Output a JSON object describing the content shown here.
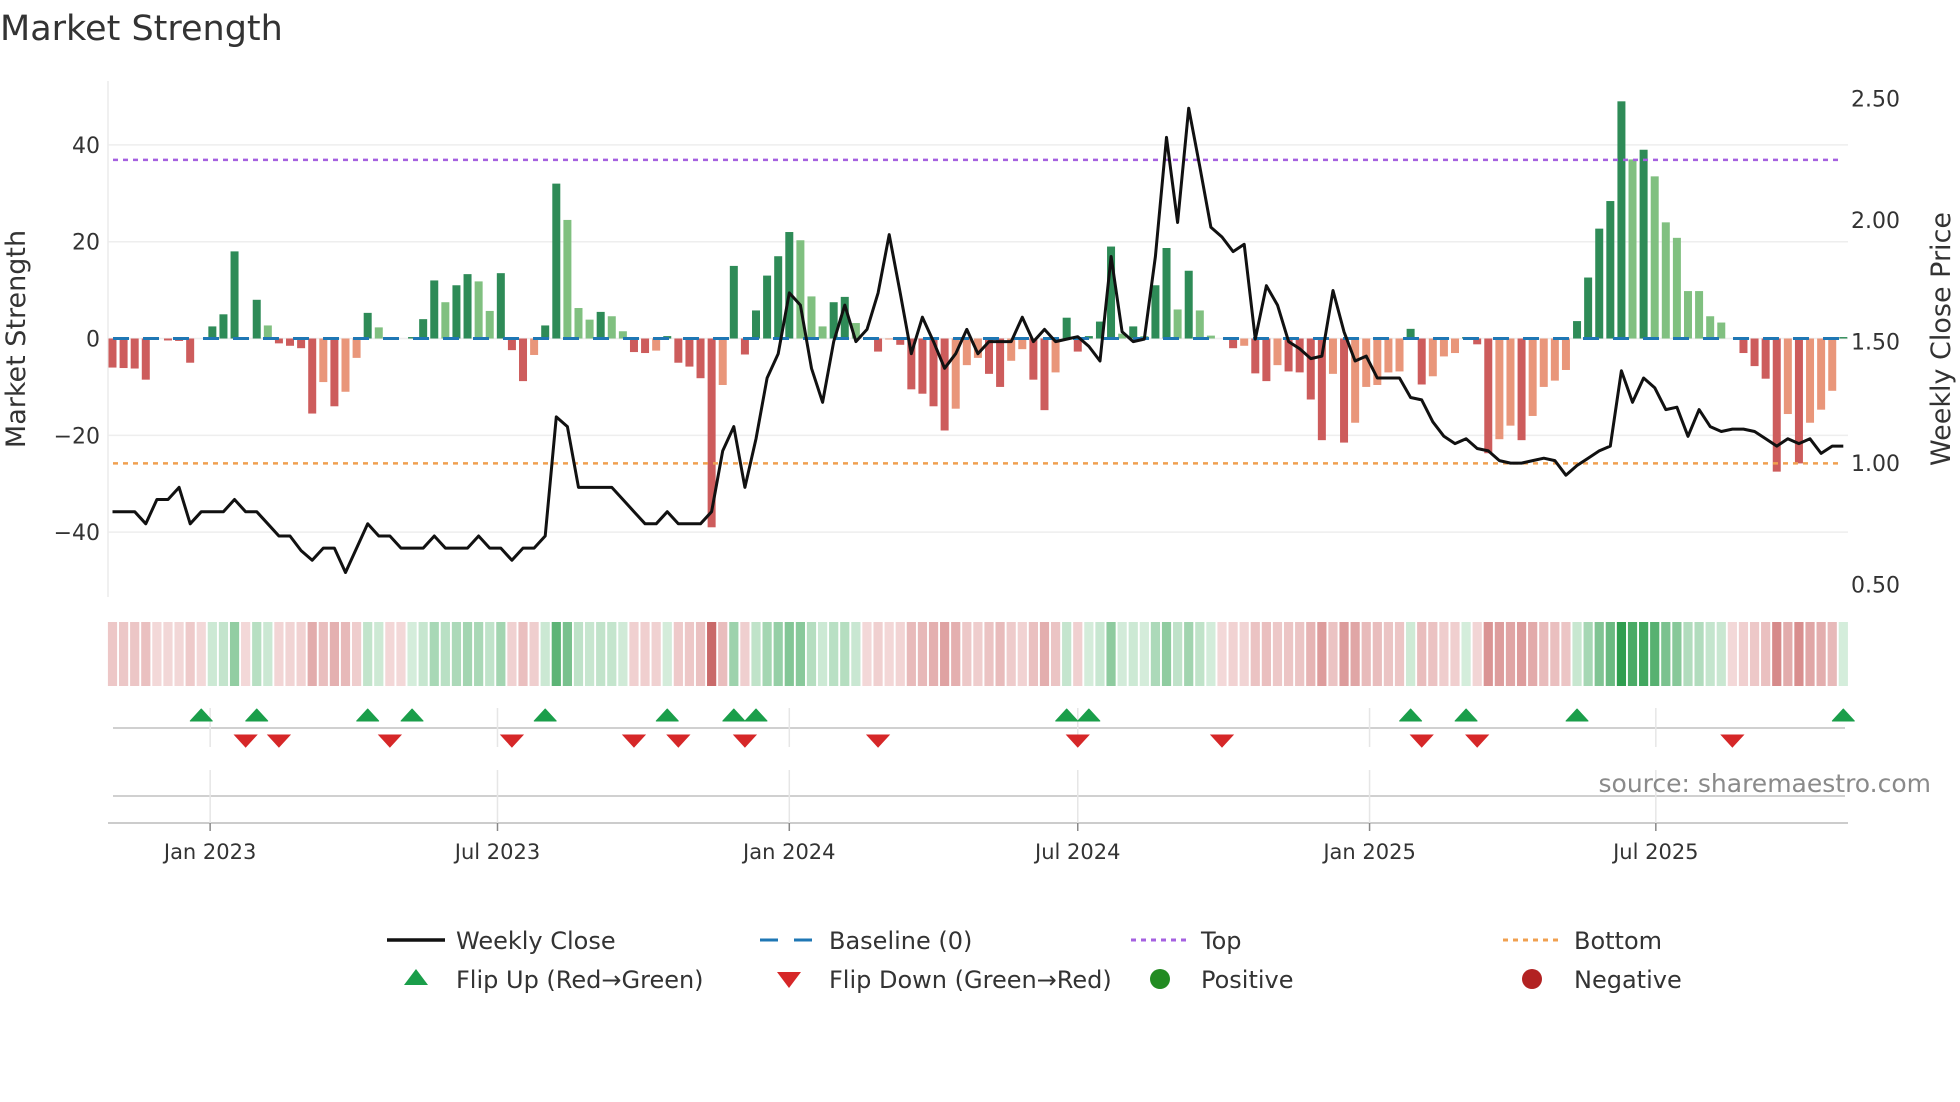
{
  "chart_data": {
    "type": "bar",
    "title": "Market Strength",
    "ylabel": "Market Strength",
    "y2label": "Weekly Close Price",
    "ylim": [
      -53.4,
      53.2
    ],
    "y2lim": [
      0.449,
      2.572
    ],
    "grid": true,
    "x_unit": "week index",
    "yticks": [
      {
        "value": 40,
        "label": "40"
      },
      {
        "value": 20,
        "label": "20"
      },
      {
        "value": 0,
        "label": "0"
      },
      {
        "value": -20,
        "label": "−20"
      },
      {
        "value": -40,
        "label": "−40"
      }
    ],
    "y2ticks": [
      {
        "value": 2.5,
        "label": "2.50"
      },
      {
        "value": 2.0,
        "label": "2.00"
      },
      {
        "value": 1.5,
        "label": "1.50"
      },
      {
        "value": 1.0,
        "label": "1.00"
      },
      {
        "value": 0.5,
        "label": "0.50"
      }
    ],
    "xticks": [
      {
        "week": 8.8,
        "label": "Jan 2023"
      },
      {
        "week": 34.7,
        "label": "Jul 2023"
      },
      {
        "week": 61,
        "label": "Jan 2024"
      },
      {
        "week": 87,
        "label": "Jul 2024"
      },
      {
        "week": 113.3,
        "label": "Jan 2025"
      },
      {
        "week": 139.1,
        "label": "Jul 2025"
      }
    ],
    "top_level": 36.9,
    "bottom_level": -25.8,
    "baseline": 0,
    "strength": [
      -6,
      -6.1,
      -6.2,
      -8.5,
      0,
      -0.4,
      -0.5,
      -5,
      0,
      2.5,
      5,
      18,
      0,
      8,
      2.7,
      -1,
      -1.5,
      -2,
      -15.5,
      -9,
      -14,
      -11,
      -4,
      5.3,
      2.3,
      -0.2,
      0,
      0.3,
      4,
      12,
      7.5,
      11,
      13.3,
      11.8,
      5.7,
      13.5,
      -2.4,
      -8.8,
      -3.4,
      2.7,
      32,
      24.5,
      6.3,
      3.9,
      5.5,
      4.6,
      1.5,
      -2.8,
      -3,
      -2.5,
      0.5,
      -5,
      -5.8,
      -8.2,
      -39,
      -9.6,
      15,
      -3.3,
      5.8,
      13,
      17,
      22,
      20.3,
      8.7,
      2.5,
      7.5,
      8.6,
      3.2,
      0,
      -2.7,
      -0.2,
      -1.3,
      -10.5,
      -11.4,
      -14,
      -19,
      -14.5,
      -5.5,
      -4,
      -7.3,
      -10,
      -4.6,
      -2.2,
      -8.5,
      -14.8,
      -7,
      4.3,
      -2.7,
      0.5,
      3.5,
      19,
      1,
      2.5,
      0.5,
      11,
      18.7,
      6,
      14,
      5.8,
      0.6,
      0,
      -2,
      -1.5,
      -7.2,
      -8.8,
      -5.5,
      -6.8,
      -7,
      -12.6,
      -21,
      -7.3,
      -21.5,
      -17.4,
      -10,
      -9.6,
      -7,
      -6.8,
      2,
      -9.5,
      -7.8,
      -3.7,
      -3,
      0.3,
      -1.2,
      -23.7,
      -20.8,
      -18,
      -21,
      -16,
      -10,
      -8.7,
      -6.5,
      3.6,
      12.6,
      22.7,
      28.4,
      49,
      37,
      39,
      33.5,
      24,
      20.8,
      9.8,
      9.8,
      4.6,
      3.3,
      0,
      -3,
      -5.7,
      -8.3,
      -27.5,
      -15.6,
      -25.8,
      -17.4,
      -14.7,
      -10.8,
      0.3
    ],
    "weekly_close": [
      0.8,
      0.8,
      0.8,
      0.75,
      0.85,
      0.85,
      0.9,
      0.75,
      0.8,
      0.8,
      0.8,
      0.85,
      0.8,
      0.8,
      0.75,
      0.7,
      0.7,
      0.64,
      0.6,
      0.65,
      0.65,
      0.55,
      0.65,
      0.75,
      0.7,
      0.7,
      0.65,
      0.65,
      0.65,
      0.7,
      0.65,
      0.65,
      0.65,
      0.7,
      0.65,
      0.65,
      0.6,
      0.65,
      0.65,
      0.7,
      1.19,
      1.15,
      0.9,
      0.9,
      0.9,
      0.9,
      0.85,
      0.8,
      0.75,
      0.75,
      0.8,
      0.75,
      0.75,
      0.75,
      0.8,
      1.05,
      1.15,
      0.9,
      1.1,
      1.35,
      1.45,
      1.7,
      1.65,
      1.39,
      1.25,
      1.5,
      1.65,
      1.5,
      1.55,
      1.7,
      1.94,
      1.7,
      1.45,
      1.6,
      1.5,
      1.39,
      1.45,
      1.55,
      1.45,
      1.5,
      1.5,
      1.5,
      1.6,
      1.5,
      1.55,
      1.5,
      1.51,
      1.52,
      1.48,
      1.42,
      1.85,
      1.54,
      1.5,
      1.51,
      1.85,
      2.34,
      1.99,
      2.46,
      2.22,
      1.97,
      1.93,
      1.87,
      1.9,
      1.51,
      1.73,
      1.65,
      1.5,
      1.47,
      1.43,
      1.44,
      1.71,
      1.54,
      1.42,
      1.44,
      1.35,
      1.35,
      1.35,
      1.27,
      1.26,
      1.17,
      1.11,
      1.08,
      1.1,
      1.06,
      1.05,
      1.01,
      1.0,
      1.0,
      1.01,
      1.02,
      1.01,
      0.95,
      0.99,
      1.02,
      1.05,
      1.07,
      1.38,
      1.25,
      1.35,
      1.31,
      1.22,
      1.23,
      1.11,
      1.22,
      1.15,
      1.13,
      1.14,
      1.14,
      1.13,
      1.1,
      1.07,
      1.1,
      1.08,
      1.1,
      1.04,
      1.07,
      1.07
    ],
    "flip_up_weeks": [
      8,
      13,
      23,
      27,
      39,
      50,
      56,
      58,
      86,
      88,
      117,
      122,
      132,
      156
    ],
    "flip_down_weeks": [
      12,
      15,
      25,
      36,
      47,
      51,
      57,
      69,
      87,
      100,
      118,
      123,
      146
    ],
    "legend": [
      {
        "label": "Weekly Close",
        "kind": "line"
      },
      {
        "label": "Baseline (0)",
        "kind": "dash"
      },
      {
        "label": "Top",
        "kind": "dot-purple"
      },
      {
        "label": "Bottom",
        "kind": "dot-orange"
      },
      {
        "label": "Flip Up (Red→Green)",
        "kind": "tri-up"
      },
      {
        "label": "Flip Down (Green→Red)",
        "kind": "tri-down"
      },
      {
        "label": "Positive",
        "kind": "circle-pos"
      },
      {
        "label": "Negative",
        "kind": "circle-neg"
      }
    ],
    "legend_position": "bottom-center",
    "source": "source: sharemaestro.com"
  },
  "colors": {
    "pos_rising": "#2e8b57",
    "pos_falling": "#80c080",
    "neg_falling": "#cd5c5c",
    "neg_rising": "#e9967a",
    "baseline": "#1f77b4",
    "top": "#a560e0",
    "bottom": "#f0a050",
    "line": "#111111",
    "flip_up": "#1a9e4a",
    "flip_down": "#d62728",
    "positive": "#228b22",
    "negative": "#b22222"
  }
}
